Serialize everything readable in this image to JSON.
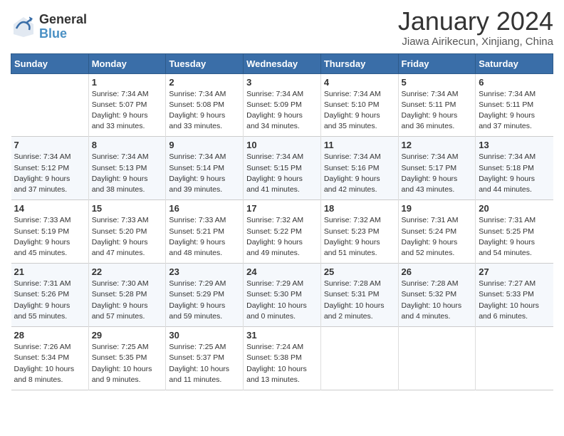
{
  "logo": {
    "general": "General",
    "blue": "Blue"
  },
  "title": "January 2024",
  "location": "Jiawa Airikecun, Xinjiang, China",
  "days_of_week": [
    "Sunday",
    "Monday",
    "Tuesday",
    "Wednesday",
    "Thursday",
    "Friday",
    "Saturday"
  ],
  "weeks": [
    [
      {
        "day": "",
        "info": ""
      },
      {
        "day": "1",
        "info": "Sunrise: 7:34 AM\nSunset: 5:07 PM\nDaylight: 9 hours\nand 33 minutes."
      },
      {
        "day": "2",
        "info": "Sunrise: 7:34 AM\nSunset: 5:08 PM\nDaylight: 9 hours\nand 33 minutes."
      },
      {
        "day": "3",
        "info": "Sunrise: 7:34 AM\nSunset: 5:09 PM\nDaylight: 9 hours\nand 34 minutes."
      },
      {
        "day": "4",
        "info": "Sunrise: 7:34 AM\nSunset: 5:10 PM\nDaylight: 9 hours\nand 35 minutes."
      },
      {
        "day": "5",
        "info": "Sunrise: 7:34 AM\nSunset: 5:11 PM\nDaylight: 9 hours\nand 36 minutes."
      },
      {
        "day": "6",
        "info": "Sunrise: 7:34 AM\nSunset: 5:11 PM\nDaylight: 9 hours\nand 37 minutes."
      }
    ],
    [
      {
        "day": "7",
        "info": "Sunrise: 7:34 AM\nSunset: 5:12 PM\nDaylight: 9 hours\nand 37 minutes."
      },
      {
        "day": "8",
        "info": "Sunrise: 7:34 AM\nSunset: 5:13 PM\nDaylight: 9 hours\nand 38 minutes."
      },
      {
        "day": "9",
        "info": "Sunrise: 7:34 AM\nSunset: 5:14 PM\nDaylight: 9 hours\nand 39 minutes."
      },
      {
        "day": "10",
        "info": "Sunrise: 7:34 AM\nSunset: 5:15 PM\nDaylight: 9 hours\nand 41 minutes."
      },
      {
        "day": "11",
        "info": "Sunrise: 7:34 AM\nSunset: 5:16 PM\nDaylight: 9 hours\nand 42 minutes."
      },
      {
        "day": "12",
        "info": "Sunrise: 7:34 AM\nSunset: 5:17 PM\nDaylight: 9 hours\nand 43 minutes."
      },
      {
        "day": "13",
        "info": "Sunrise: 7:34 AM\nSunset: 5:18 PM\nDaylight: 9 hours\nand 44 minutes."
      }
    ],
    [
      {
        "day": "14",
        "info": "Sunrise: 7:33 AM\nSunset: 5:19 PM\nDaylight: 9 hours\nand 45 minutes."
      },
      {
        "day": "15",
        "info": "Sunrise: 7:33 AM\nSunset: 5:20 PM\nDaylight: 9 hours\nand 47 minutes."
      },
      {
        "day": "16",
        "info": "Sunrise: 7:33 AM\nSunset: 5:21 PM\nDaylight: 9 hours\nand 48 minutes."
      },
      {
        "day": "17",
        "info": "Sunrise: 7:32 AM\nSunset: 5:22 PM\nDaylight: 9 hours\nand 49 minutes."
      },
      {
        "day": "18",
        "info": "Sunrise: 7:32 AM\nSunset: 5:23 PM\nDaylight: 9 hours\nand 51 minutes."
      },
      {
        "day": "19",
        "info": "Sunrise: 7:31 AM\nSunset: 5:24 PM\nDaylight: 9 hours\nand 52 minutes."
      },
      {
        "day": "20",
        "info": "Sunrise: 7:31 AM\nSunset: 5:25 PM\nDaylight: 9 hours\nand 54 minutes."
      }
    ],
    [
      {
        "day": "21",
        "info": "Sunrise: 7:31 AM\nSunset: 5:26 PM\nDaylight: 9 hours\nand 55 minutes."
      },
      {
        "day": "22",
        "info": "Sunrise: 7:30 AM\nSunset: 5:28 PM\nDaylight: 9 hours\nand 57 minutes."
      },
      {
        "day": "23",
        "info": "Sunrise: 7:29 AM\nSunset: 5:29 PM\nDaylight: 9 hours\nand 59 minutes."
      },
      {
        "day": "24",
        "info": "Sunrise: 7:29 AM\nSunset: 5:30 PM\nDaylight: 10 hours\nand 0 minutes."
      },
      {
        "day": "25",
        "info": "Sunrise: 7:28 AM\nSunset: 5:31 PM\nDaylight: 10 hours\nand 2 minutes."
      },
      {
        "day": "26",
        "info": "Sunrise: 7:28 AM\nSunset: 5:32 PM\nDaylight: 10 hours\nand 4 minutes."
      },
      {
        "day": "27",
        "info": "Sunrise: 7:27 AM\nSunset: 5:33 PM\nDaylight: 10 hours\nand 6 minutes."
      }
    ],
    [
      {
        "day": "28",
        "info": "Sunrise: 7:26 AM\nSunset: 5:34 PM\nDaylight: 10 hours\nand 8 minutes."
      },
      {
        "day": "29",
        "info": "Sunrise: 7:25 AM\nSunset: 5:35 PM\nDaylight: 10 hours\nand 9 minutes."
      },
      {
        "day": "30",
        "info": "Sunrise: 7:25 AM\nSunset: 5:37 PM\nDaylight: 10 hours\nand 11 minutes."
      },
      {
        "day": "31",
        "info": "Sunrise: 7:24 AM\nSunset: 5:38 PM\nDaylight: 10 hours\nand 13 minutes."
      },
      {
        "day": "",
        "info": ""
      },
      {
        "day": "",
        "info": ""
      },
      {
        "day": "",
        "info": ""
      }
    ]
  ]
}
